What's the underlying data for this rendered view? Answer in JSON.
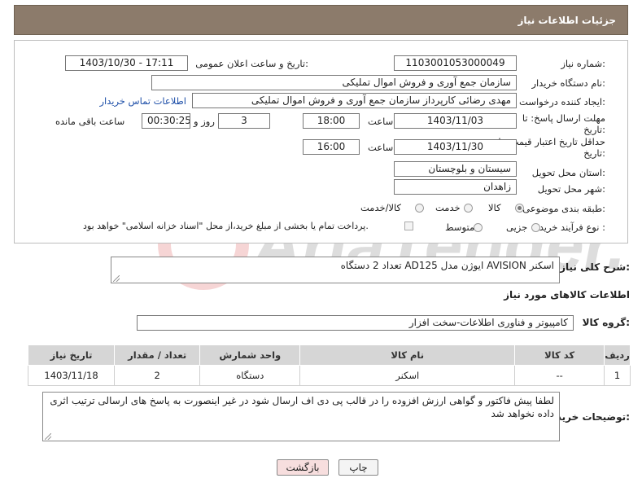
{
  "header": {
    "title": "جزئیات اطلاعات نیاز"
  },
  "fields": {
    "need_number_label": "شماره نیاز:",
    "need_number": "1103001053000049",
    "announce_label": "تاریخ و ساعت اعلان عمومی:",
    "announce_value": "1403/10/30 - 17:11",
    "buyer_org_label": "نام دستگاه خریدار:",
    "buyer_org": "سازمان جمع آوری و فروش اموال تملیکی",
    "requester_label": "ایجاد کننده درخواست:",
    "requester": "مهدی رضائی کارپرداز  سازمان جمع آوری و فروش اموال تملیکی",
    "contact_link": "اطلاعات تماس خریدار",
    "deadline_label": "مهلت ارسال پاسخ: تا",
    "deadline_label2": "تاریخ:",
    "deadline_date": "1403/11/03",
    "time_label": "ساعت",
    "deadline_time": "18:00",
    "days_value": "3",
    "days_label": "روز و",
    "remaining_value": "00:30:25",
    "remaining_label": "ساعت باقی مانده",
    "price_label": "حداقل تاریخ اعتبار قیمت: تا",
    "price_label2": "تاریخ:",
    "price_date": "1403/11/30",
    "price_time_label": "ساعت",
    "price_time": "16:00",
    "province_label": "استان محل تحویل:",
    "province": "سیستان و بلوچستان",
    "city_label": "شهر محل تحویل:",
    "city": "زاهدان",
    "category_label": "طبقه بندی موضوعی:",
    "category_options": [
      "کالا",
      "خدمت",
      "کالا/خدمت"
    ],
    "category_selected": "کالا",
    "process_label": "نوع فرآیند خرید :",
    "process_options": [
      "جزیی",
      "متوسط"
    ],
    "process_note": "پرداخت تمام یا بخشی از مبلغ خرید،از محل \"اسناد خزانه اسلامی\" خواهد بود."
  },
  "description": {
    "label": "شرح کلی نیاز:",
    "text": "اسکنر  AVISION ایوژن مدل AD125 تعداد 2 دستگاه"
  },
  "goods_info_title": "اطلاعات کالاهای مورد نیاز",
  "goods_group": {
    "label": "گروه کالا:",
    "value": "کامپیوتر و فناوری اطلاعات-سخت افزار"
  },
  "table": {
    "headers": [
      "ردیف",
      "کد کالا",
      "نام کالا",
      "واحد شمارش",
      "تعداد / مقدار",
      "تاریخ نیاز"
    ],
    "rows": [
      [
        "1",
        "--",
        "اسکنر",
        "دستگاه",
        "2",
        "1403/11/18"
      ]
    ]
  },
  "buyer_notes": {
    "label": "توضیحات خریدار:",
    "text": "لطفا پیش فاکتور و گواهی ارزش افزوده را در قالب پی دی اف ارسال شود در غیر اینصورت به پاسخ های ارسالی ترتیب اثری داده نخواهد شد"
  },
  "buttons": {
    "print": "چاپ",
    "back": "بازگشت"
  },
  "watermark": {
    "text": "AriaTender.net"
  },
  "colors": {
    "header_bg": "#8c7b6b",
    "link": "#1e4fa8",
    "back_btn_bg": "#f7dede"
  }
}
